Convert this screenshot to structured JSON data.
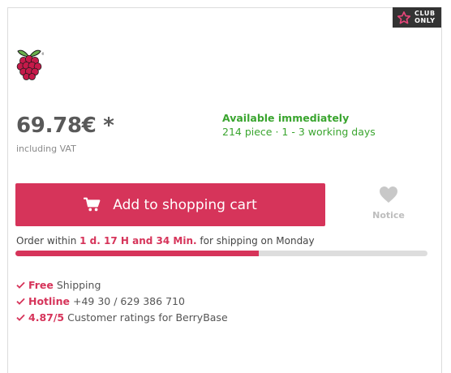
{
  "badge": {
    "line1": "CLUB",
    "line2": "ONLY",
    "icon": "star-icon"
  },
  "logo": {
    "icon": "raspberry-pi-logo"
  },
  "price": {
    "amount": "69.78€ *",
    "vat_note": "including VAT"
  },
  "availability": {
    "title": "Available immediately",
    "detail": "214 piece · 1 - 3 working days"
  },
  "cart_button": {
    "label": "Add to shopping cart",
    "icon": "cart-icon"
  },
  "notice": {
    "label": "Notice",
    "icon": "heart-icon"
  },
  "shipping_timer": {
    "prefix": "Order within",
    "time": "1 d. 17 H and 34 Min.",
    "suffix": "for shipping on Monday",
    "progress_fraction": 0.59
  },
  "benefits": [
    {
      "highlight": "Free",
      "text": "Shipping"
    },
    {
      "highlight": "Hotline",
      "text": "+49 30 / 629 386 710"
    },
    {
      "highlight": "4.87/5",
      "text": "Customer ratings for BerryBase"
    }
  ],
  "colors": {
    "accent": "#d6345a",
    "available": "#3aa52f",
    "badge_bg": "#333333",
    "muted": "#bdbdbd"
  }
}
